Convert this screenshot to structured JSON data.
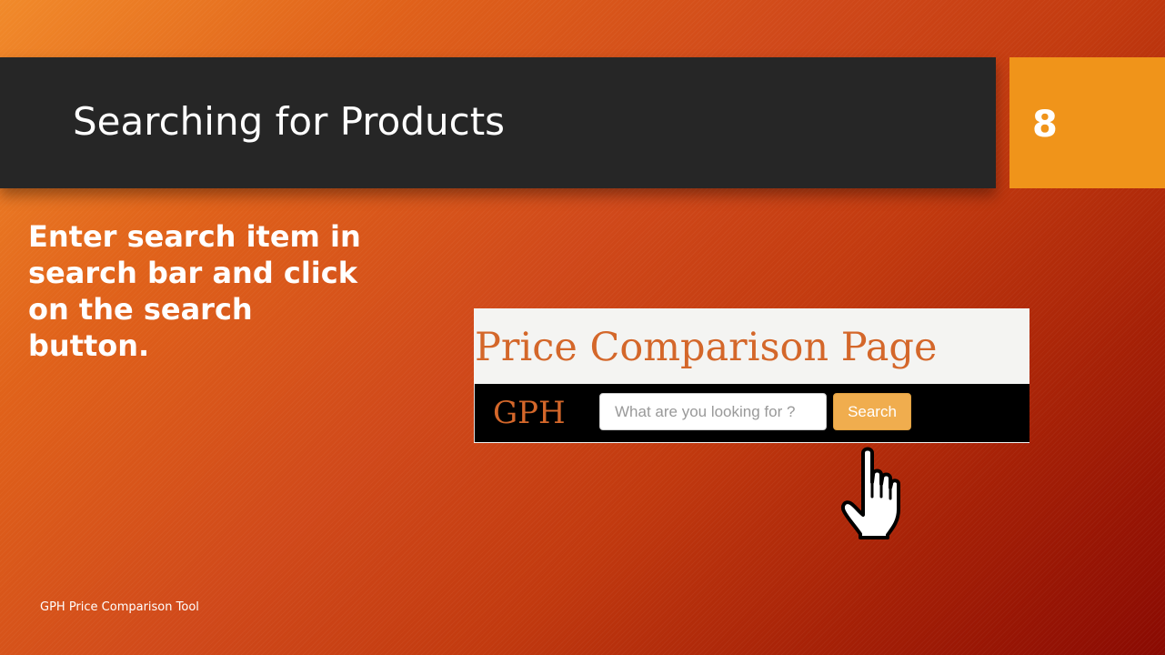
{
  "slide": {
    "title": "Searching for Products",
    "number": "8",
    "body": "Enter search item in search bar and click on the search button.",
    "footer": "GPH Price Comparison Tool"
  },
  "screenshot": {
    "page_title": "Price Comparison Page",
    "brand": "GPH",
    "search_placeholder": "What are you looking for ?",
    "search_button": "Search"
  },
  "colors": {
    "title_bar": "#262626",
    "slide_number_box": "#f0941a",
    "accent_text": "#d4672a",
    "search_button": "#f0ad4e"
  },
  "icons": {
    "pointer": "pointing-hand-icon"
  }
}
